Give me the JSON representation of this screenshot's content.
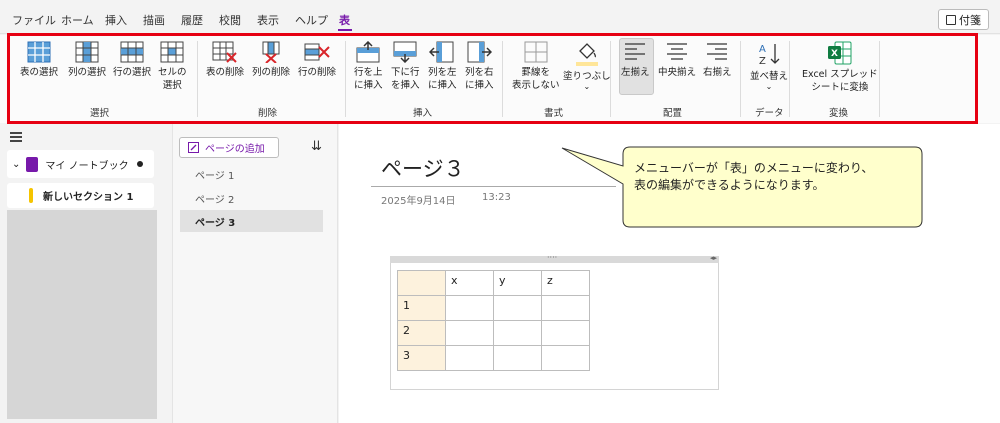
{
  "menubar": {
    "items": [
      "ファイル",
      "ホーム",
      "挿入",
      "描画",
      "履歴",
      "校閲",
      "表示",
      "ヘルプ",
      "表"
    ],
    "active": "表",
    "fusen_label": "付箋"
  },
  "ribbon": {
    "select": {
      "group": "選択",
      "buttons": [
        "表の選択",
        "列の選択",
        "行の選択",
        "セルの\n選択"
      ]
    },
    "delete": {
      "group": "削除",
      "buttons": [
        "表の削除",
        "列の削除",
        "行の削除"
      ]
    },
    "insert": {
      "group": "挿入",
      "buttons": [
        "行を上\nに挿入",
        "下に行\nを挿入",
        "列を左\nに挿入",
        "列を右\nに挿入"
      ]
    },
    "format": {
      "group": "書式",
      "buttons": [
        "罫線を\n表示しない",
        "塗りつぶし"
      ]
    },
    "align": {
      "group": "配置",
      "buttons": [
        "左揃え",
        "中央揃え",
        "右揃え"
      ]
    },
    "data": {
      "group": "データ",
      "buttons": [
        "並べ替え"
      ]
    },
    "convert": {
      "group": "変換",
      "buttons": [
        "Excel スプレッド\nシートに変換"
      ]
    }
  },
  "nav": {
    "notebook": "マイ ノートブック",
    "section": "新しいセクション 1"
  },
  "pages": {
    "add_label": "ページの追加",
    "items": [
      "ページ 1",
      "ページ 2",
      "ページ 3"
    ]
  },
  "page": {
    "title": "ページ３",
    "date": "2025年9月14日",
    "time": "13:23"
  },
  "table": {
    "header": [
      "",
      "x",
      "y",
      "z"
    ],
    "rows": [
      [
        "1",
        "",
        "",
        ""
      ],
      [
        "2",
        "",
        "",
        ""
      ],
      [
        "3",
        "",
        "",
        ""
      ]
    ]
  },
  "callout": {
    "line1": "メニューバーが「表」のメニューに変わり、",
    "line2": "表の編集ができるようになります。"
  },
  "colors": {
    "accent": "#7719aa",
    "highlight_frame": "#e60012",
    "callout_fill": "#ffffcc",
    "header_cell": "#fdf2dd"
  }
}
